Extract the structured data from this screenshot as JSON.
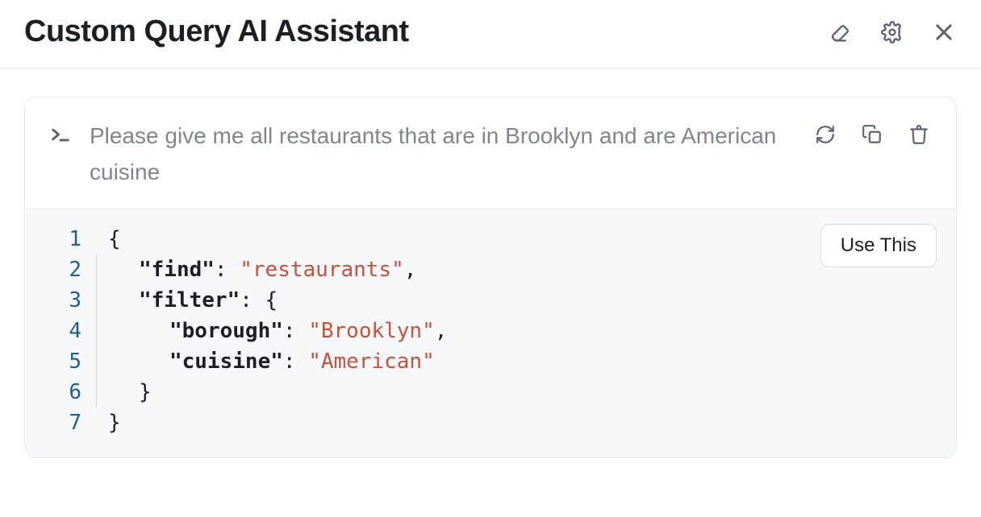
{
  "header": {
    "title": "Custom Query AI Assistant"
  },
  "prompt": {
    "text": "Please give me all restaurants that are in Brooklyn and are American cuisine"
  },
  "actions": {
    "use_label": "Use This"
  },
  "code": {
    "lines": [
      "1",
      "2",
      "3",
      "4",
      "5",
      "6",
      "7"
    ],
    "l1_open": "{",
    "l2_key": "\"find\"",
    "l2_val": "\"restaurants\"",
    "l3_key": "\"filter\"",
    "l3_open": "{",
    "l4_key": "\"borough\"",
    "l4_val": "\"Brooklyn\"",
    "l5_key": "\"cuisine\"",
    "l5_val": "\"American\"",
    "l6_close": "}",
    "l7_close": "}",
    "colon": ":",
    "comma": ","
  }
}
